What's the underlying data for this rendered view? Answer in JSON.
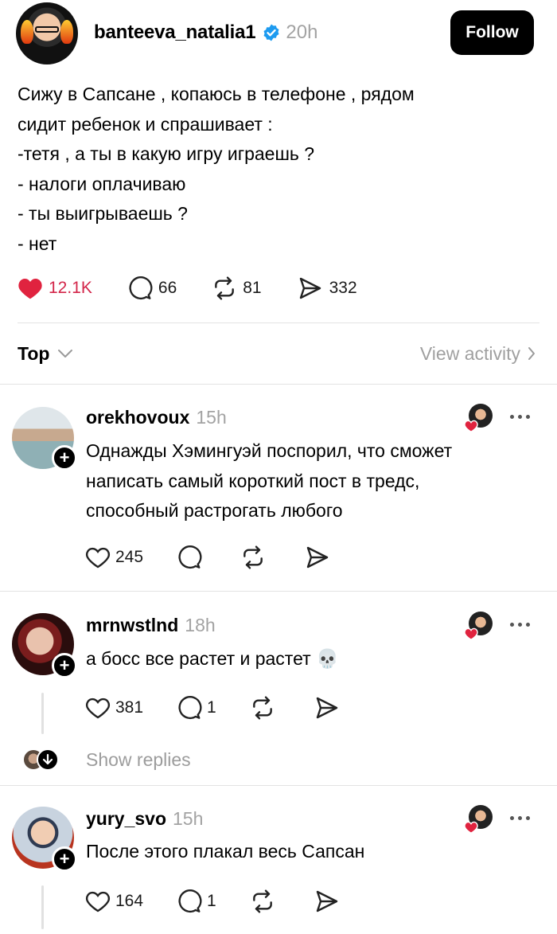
{
  "post": {
    "author": "banteeva_natalia1",
    "time": "20h",
    "follow_label": "Follow",
    "text_lines": [
      "Сижу в Сапсане , копаюсь в телефоне , рядом",
      "сидит ребенок и спрашивает :",
      "-тетя , а ты в какую игру играешь ?",
      "- налоги оплачиваю",
      "- ты выигрываешь ?",
      "- нет"
    ],
    "likes": "12.1K",
    "comments": "66",
    "reposts": "81",
    "shares": "332",
    "liked": true,
    "accent_like_color": "#d3264a",
    "verified_color": "#1d9bf0"
  },
  "sort": {
    "label": "Top",
    "view_activity": "View activity"
  },
  "replies": [
    {
      "author": "orekhovoux",
      "time": "15h",
      "text": "Однажды Хэмингуэй поспорил, что сможет\nнаписать самый короткий пост в тредс,\nспособный растрогать любого",
      "likes": "245",
      "comments": "",
      "author_liked": true
    },
    {
      "author": "mrnwstlnd",
      "time": "18h",
      "text": "а босс все растет и растет 💀",
      "likes": "381",
      "comments": "1",
      "author_liked": true,
      "show_replies": "Show replies"
    },
    {
      "author": "yury_svo",
      "time": "15h",
      "text": "После этого плакал весь Сапсан",
      "likes": "164",
      "comments": "1",
      "author_liked": true
    }
  ]
}
